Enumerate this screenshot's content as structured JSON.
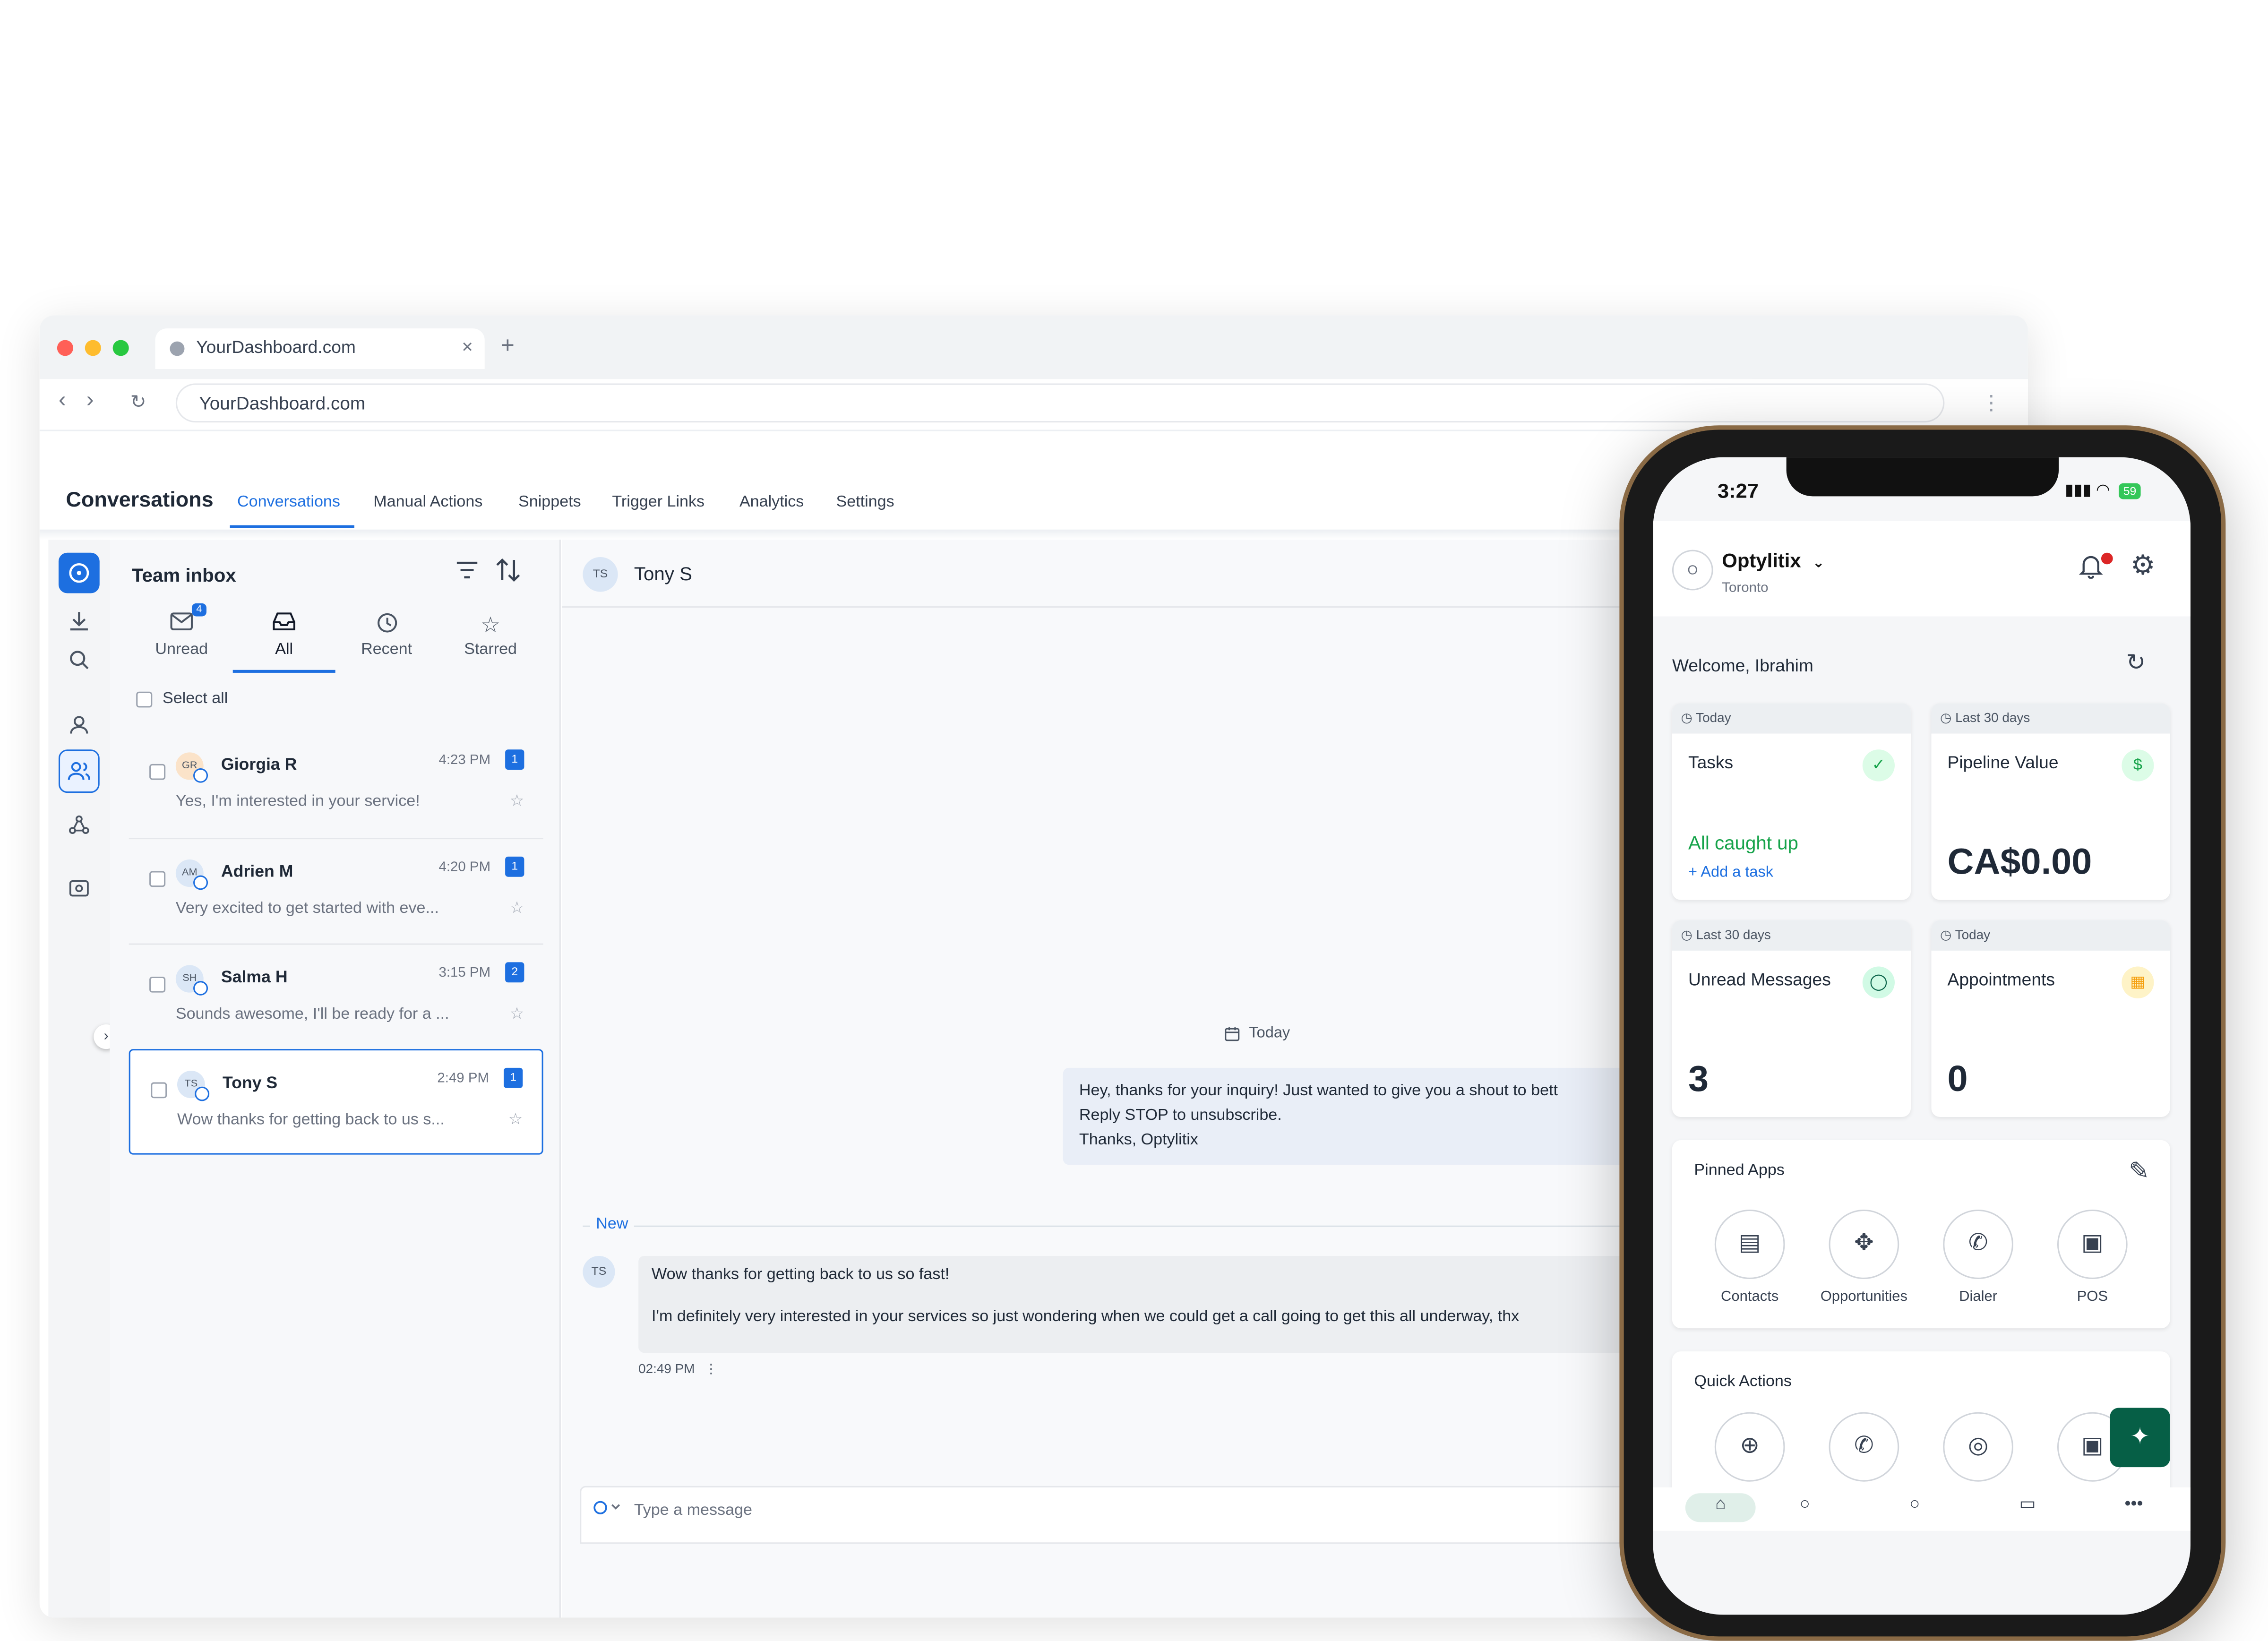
{
  "browser": {
    "tab_title": "YourDashboard.com",
    "url": "YourDashboard.com",
    "tab_close": "×",
    "new_tab": "+"
  },
  "app": {
    "title": "Conversations",
    "nav_tabs": [
      "Conversations",
      "Manual Actions",
      "Snippets",
      "Trigger Links",
      "Analytics",
      "Settings"
    ],
    "active_tab": "Conversations"
  },
  "inbox": {
    "title": "Team inbox",
    "filters": [
      {
        "label": "Unread",
        "badge": "4"
      },
      {
        "label": "All"
      },
      {
        "label": "Recent"
      },
      {
        "label": "Starred"
      }
    ],
    "active_filter": "All",
    "select_all": "Select all",
    "conversations": [
      {
        "initials": "GR",
        "name": "Giorgia R",
        "time": "4:23 PM",
        "count": "1",
        "preview": "Yes, I'm interested in your service!"
      },
      {
        "initials": "AM",
        "name": "Adrien M",
        "time": "4:20 PM",
        "count": "1",
        "preview": "Very excited to get started with eve..."
      },
      {
        "initials": "SH",
        "name": "Salma H",
        "time": "3:15 PM",
        "count": "2",
        "preview": "Sounds awesome, I'll be ready for a ..."
      },
      {
        "initials": "TS",
        "name": "Tony S",
        "time": "2:49 PM",
        "count": "1",
        "preview": "Wow thanks for getting back to us s..."
      }
    ]
  },
  "chat": {
    "contact_initials": "TS",
    "contact_name": "Tony S",
    "day_label": "Today",
    "outgoing_lines": [
      "Hey, thanks for your inquiry! Just wanted to give you a shout to bett",
      "Reply STOP to unsubscribe.",
      "Thanks, Optylitix"
    ],
    "new_label": "New",
    "incoming_initials": "TS",
    "incoming_lines": [
      "Wow thanks for getting back to us so fast!",
      "I'm definitely very interested in your services so just wondering when we could get a call going to get this all underway, thx"
    ],
    "incoming_time": "02:49 PM",
    "incoming_more": "⋮",
    "composer_placeholder": "Type a message"
  },
  "phone": {
    "time": "3:27",
    "battery": "59",
    "org_initial": "O",
    "org_name": "Optylitix",
    "org_location": "Toronto",
    "welcome": "Welcome, Ibrahim",
    "cards": [
      {
        "period": "Today",
        "title": "Tasks",
        "status": "All caught up",
        "action": "+ Add a task",
        "icon_color": "#16a34a"
      },
      {
        "period": "Last 30 days",
        "title": "Pipeline Value",
        "value": "CA$0.00",
        "icon_color": "#16a34a"
      },
      {
        "period": "Last 30 days",
        "title": "Unread Messages",
        "value": "3",
        "icon_color": "#065f46"
      },
      {
        "period": "Today",
        "title": "Appointments",
        "value": "0",
        "icon_color": "#f59e0b"
      }
    ],
    "pinned_title": "Pinned Apps",
    "pinned_apps": [
      "Contacts",
      "Opportunities",
      "Dialer",
      "POS"
    ],
    "quick_title": "Quick Actions"
  },
  "icons": {
    "accent": "#1d6fe0"
  }
}
